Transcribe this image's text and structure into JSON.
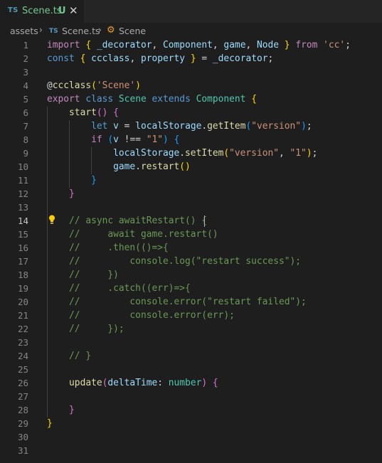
{
  "tab": {
    "lang": "TS",
    "title": "Scene.ts",
    "status": "U",
    "close": "✕"
  },
  "breadcrumb": {
    "folder": "assets",
    "file_lang": "TS",
    "file": "Scene.ts",
    "symbol": "Scene"
  },
  "editor": {
    "current_line": 14,
    "lines": [
      [
        [
          "kw",
          "import"
        ],
        [
          "pl",
          " "
        ],
        [
          "b1",
          "{"
        ],
        [
          "pl",
          " "
        ],
        [
          "id",
          "_decorator"
        ],
        [
          "pl",
          ", "
        ],
        [
          "id",
          "Component"
        ],
        [
          "pl",
          ", "
        ],
        [
          "id",
          "game"
        ],
        [
          "pl",
          ", "
        ],
        [
          "id",
          "Node"
        ],
        [
          "pl",
          " "
        ],
        [
          "b1",
          "}"
        ],
        [
          "pl",
          " "
        ],
        [
          "kw",
          "from"
        ],
        [
          "pl",
          " "
        ],
        [
          "str",
          "'cc'"
        ],
        [
          "pl",
          ";"
        ]
      ],
      [
        [
          "st",
          "const"
        ],
        [
          "pl",
          " "
        ],
        [
          "b1",
          "{"
        ],
        [
          "pl",
          " "
        ],
        [
          "id",
          "ccclass"
        ],
        [
          "pl",
          ", "
        ],
        [
          "id",
          "property"
        ],
        [
          "pl",
          " "
        ],
        [
          "b1",
          "}"
        ],
        [
          "pl",
          " = "
        ],
        [
          "id",
          "_decorator"
        ],
        [
          "pl",
          ";"
        ]
      ],
      [],
      [
        [
          "pl",
          "@"
        ],
        [
          "fn",
          "ccclass"
        ],
        [
          "b1",
          "("
        ],
        [
          "str",
          "'Scene'"
        ],
        [
          "b1",
          ")"
        ]
      ],
      [
        [
          "kw",
          "export"
        ],
        [
          "pl",
          " "
        ],
        [
          "st",
          "class"
        ],
        [
          "pl",
          " "
        ],
        [
          "ty",
          "Scene"
        ],
        [
          "pl",
          " "
        ],
        [
          "st",
          "extends"
        ],
        [
          "pl",
          " "
        ],
        [
          "ty",
          "Component"
        ],
        [
          "pl",
          " "
        ],
        [
          "b1",
          "{"
        ]
      ],
      [
        [
          "pl",
          "    "
        ],
        [
          "fn",
          "start"
        ],
        [
          "b2",
          "()"
        ],
        [
          "pl",
          " "
        ],
        [
          "b2",
          "{"
        ]
      ],
      [
        [
          "pl",
          "        "
        ],
        [
          "st",
          "let"
        ],
        [
          "pl",
          " "
        ],
        [
          "id",
          "v"
        ],
        [
          "pl",
          " = "
        ],
        [
          "id",
          "localStorage"
        ],
        [
          "pl",
          "."
        ],
        [
          "fn",
          "getItem"
        ],
        [
          "b3",
          "("
        ],
        [
          "str",
          "\"version\""
        ],
        [
          "b3",
          ")"
        ],
        [
          "pl",
          ";"
        ]
      ],
      [
        [
          "pl",
          "        "
        ],
        [
          "kw",
          "if"
        ],
        [
          "pl",
          " "
        ],
        [
          "b3",
          "("
        ],
        [
          "id",
          "v"
        ],
        [
          "pl",
          " !== "
        ],
        [
          "str",
          "\"1\""
        ],
        [
          "b3",
          ")"
        ],
        [
          "pl",
          " "
        ],
        [
          "b3",
          "{"
        ]
      ],
      [
        [
          "pl",
          "            "
        ],
        [
          "id",
          "localStorage"
        ],
        [
          "pl",
          "."
        ],
        [
          "fn",
          "setItem"
        ],
        [
          "b1",
          "("
        ],
        [
          "str",
          "\"version\""
        ],
        [
          "pl",
          ", "
        ],
        [
          "str",
          "\"1\""
        ],
        [
          "b1",
          ")"
        ],
        [
          "pl",
          ";"
        ]
      ],
      [
        [
          "pl",
          "            "
        ],
        [
          "id",
          "game"
        ],
        [
          "pl",
          "."
        ],
        [
          "fn",
          "restart"
        ],
        [
          "b1",
          "()"
        ]
      ],
      [
        [
          "pl",
          "        "
        ],
        [
          "b3",
          "}"
        ]
      ],
      [
        [
          "pl",
          "    "
        ],
        [
          "b2",
          "}"
        ]
      ],
      [],
      [
        [
          "pl",
          "    "
        ],
        [
          "cm",
          "// async awaitRestart() {"
        ]
      ],
      [
        [
          "pl",
          "    "
        ],
        [
          "cm",
          "//     await game.restart()"
        ]
      ],
      [
        [
          "pl",
          "    "
        ],
        [
          "cm",
          "//     .then(()=>{"
        ]
      ],
      [
        [
          "pl",
          "    "
        ],
        [
          "cm",
          "//         console.log(\"restart success\");"
        ]
      ],
      [
        [
          "pl",
          "    "
        ],
        [
          "cm",
          "//     })"
        ]
      ],
      [
        [
          "pl",
          "    "
        ],
        [
          "cm",
          "//     .catch((err)=>{"
        ]
      ],
      [
        [
          "pl",
          "    "
        ],
        [
          "cm",
          "//         console.error(\"restart failed\");"
        ]
      ],
      [
        [
          "pl",
          "    "
        ],
        [
          "cm",
          "//         console.error(err);"
        ]
      ],
      [
        [
          "pl",
          "    "
        ],
        [
          "cm",
          "//     });"
        ]
      ],
      [],
      [
        [
          "pl",
          "    "
        ],
        [
          "cm",
          "// }"
        ]
      ],
      [],
      [
        [
          "pl",
          "    "
        ],
        [
          "fn",
          "update"
        ],
        [
          "b2",
          "("
        ],
        [
          "id",
          "deltaTime"
        ],
        [
          "pl",
          ": "
        ],
        [
          "ty",
          "number"
        ],
        [
          "b2",
          ")"
        ],
        [
          "pl",
          " "
        ],
        [
          "b2",
          "{"
        ]
      ],
      [],
      [
        [
          "pl",
          "    "
        ],
        [
          "b2",
          "}"
        ]
      ],
      [
        [
          "b1",
          "}"
        ]
      ],
      [],
      []
    ]
  }
}
